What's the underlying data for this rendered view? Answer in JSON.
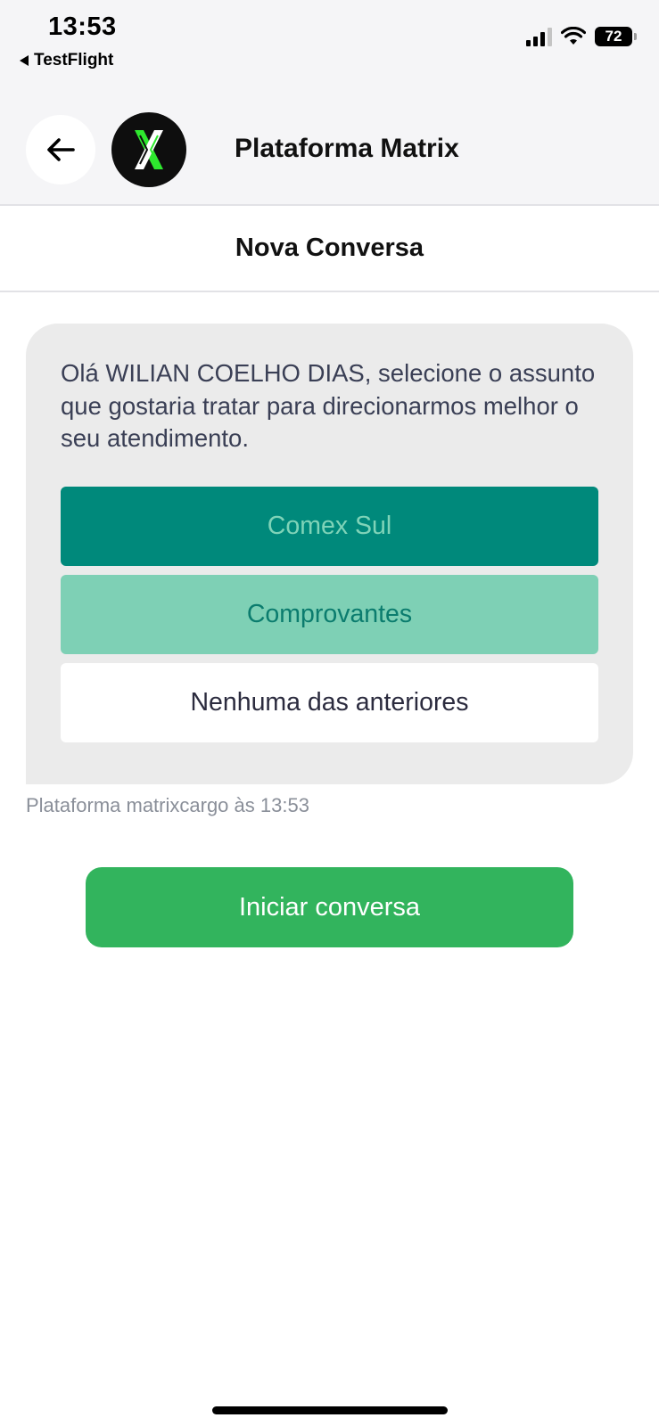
{
  "status_bar": {
    "time": "13:53",
    "back_app_label": "TestFlight",
    "battery_level": "72"
  },
  "header": {
    "title": "Plataforma Matrix",
    "back_icon": "arrow-left-icon",
    "avatar_icon": "matrix-x-logo"
  },
  "subheader": {
    "title": "Nova Conversa"
  },
  "message": {
    "text": "Olá WILIAN COELHO DIAS, selecione o assunto que gostaria tratar para direcionarmos melhor o seu atendimento.",
    "options": [
      {
        "label": "Comex Sul",
        "bg": "#00897b",
        "color": "#7fd3b8"
      },
      {
        "label": "Comprovantes",
        "bg": "#7ed0b5",
        "color": "#0b7c6e"
      },
      {
        "label": "Nenhuma das anteriores",
        "bg": "#ffffff",
        "color": "#2b2b3e"
      }
    ],
    "meta": "Plataforma matrixcargo às 13:53"
  },
  "start_button": {
    "label": "Iniciar conversa",
    "color": "#32b45d"
  }
}
